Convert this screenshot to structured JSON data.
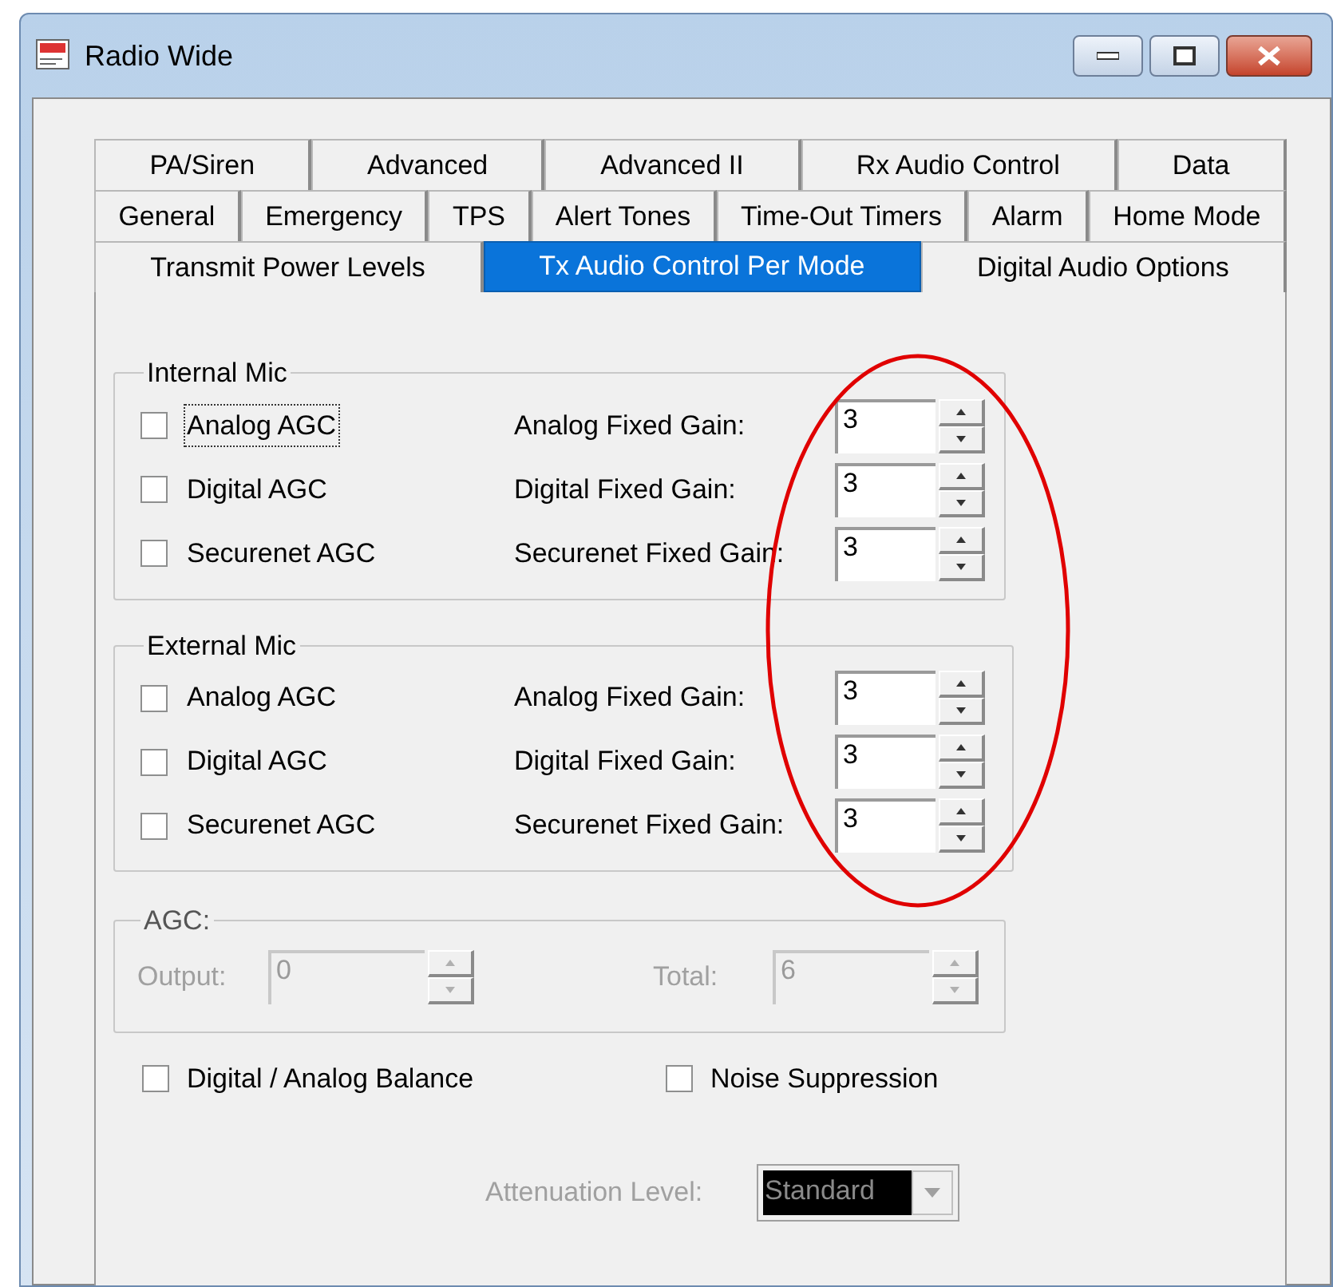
{
  "window": {
    "title": "Radio Wide"
  },
  "tab_rows": [
    [
      {
        "label": "PA/Siren",
        "selected": false
      },
      {
        "label": "Advanced",
        "selected": false
      },
      {
        "label": "Advanced II",
        "selected": false
      },
      {
        "label": "Rx Audio Control",
        "selected": false
      },
      {
        "label": "Data",
        "selected": false
      }
    ],
    [
      {
        "label": "General",
        "selected": false
      },
      {
        "label": "Emergency",
        "selected": false
      },
      {
        "label": "TPS",
        "selected": false
      },
      {
        "label": "Alert Tones",
        "selected": false
      },
      {
        "label": "Time-Out Timers",
        "selected": false
      },
      {
        "label": "Alarm",
        "selected": false
      },
      {
        "label": "Home Mode",
        "selected": false
      }
    ],
    [
      {
        "label": "Transmit Power Levels",
        "selected": false
      },
      {
        "label": "Tx Audio Control Per Mode",
        "selected": true
      },
      {
        "label": "Digital Audio Options",
        "selected": false
      }
    ]
  ],
  "groups": [
    {
      "title": "Internal Mic",
      "rows": [
        {
          "label": "Analog AGC",
          "checked": false,
          "focused": true,
          "gain_label": "Analog Fixed Gain:",
          "gain_value": "3"
        },
        {
          "label": "Digital AGC",
          "checked": false,
          "focused": false,
          "gain_label": "Digital Fixed Gain:",
          "gain_value": "3"
        },
        {
          "label": "Securenet AGC",
          "checked": false,
          "focused": false,
          "gain_label": "Securenet Fixed Gain:",
          "gain_value": "3"
        }
      ]
    },
    {
      "title": "External Mic",
      "rows": [
        {
          "label": "Analog AGC",
          "checked": false,
          "focused": false,
          "gain_label": "Analog Fixed Gain:",
          "gain_value": "3"
        },
        {
          "label": "Digital AGC",
          "checked": false,
          "focused": false,
          "gain_label": "Digital Fixed Gain:",
          "gain_value": "3"
        },
        {
          "label": "Securenet AGC",
          "checked": false,
          "focused": false,
          "gain_label": "Securenet Fixed Gain:",
          "gain_value": "3"
        }
      ]
    }
  ],
  "agc": {
    "title": "AGC:",
    "disabled": true,
    "output_label": "Output:",
    "output_value": "0",
    "total_label": "Total:",
    "total_value": "6"
  },
  "options": [
    {
      "label": "Digital / Analog Balance",
      "checked": false
    },
    {
      "label": "Noise Suppression",
      "checked": false
    }
  ],
  "attenuation": {
    "label": "Attenuation Level:",
    "value": "Standard",
    "disabled": true
  }
}
